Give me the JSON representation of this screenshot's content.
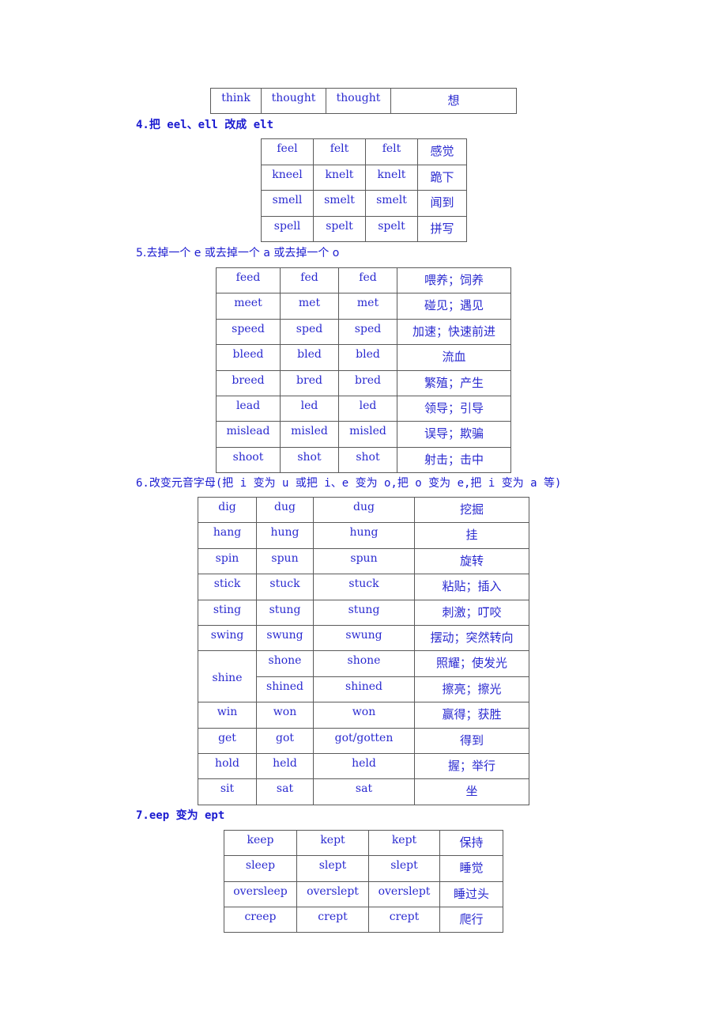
{
  "table_think": [
    [
      "think",
      "thought",
      "thought",
      "想"
    ]
  ],
  "section4": {
    "heading": "4.把 eel、ell 改成 elt",
    "rows": [
      [
        "feel",
        "felt",
        "felt",
        "感觉"
      ],
      [
        "kneel",
        "knelt",
        "knelt",
        "跪下"
      ],
      [
        "smell",
        "smelt",
        "smelt",
        "闻到"
      ],
      [
        "spell",
        "spelt",
        "spelt",
        "拼写"
      ]
    ]
  },
  "section5": {
    "heading": "5.去掉一个 e 或去掉一个 a 或去掉一个 o",
    "rows": [
      [
        "feed",
        "fed",
        "fed",
        "喂养；饲养"
      ],
      [
        "meet",
        "met",
        "met",
        "碰见；遇见"
      ],
      [
        "speed",
        "sped",
        "sped",
        "加速；快速前进"
      ],
      [
        "bleed",
        "bled",
        "bled",
        "流血"
      ],
      [
        "breed",
        "bred",
        "bred",
        "繁殖；产生"
      ],
      [
        "lead",
        "led",
        "led",
        "领导；引导"
      ],
      [
        "mislead",
        "misled",
        "misled",
        "误导；欺骗"
      ],
      [
        "shoot",
        "shot",
        "shot",
        "射击；击中"
      ]
    ]
  },
  "section6": {
    "heading": "6.改变元音字母(把 i 变为 u 或把 i、e 变为 o,把 o 变为 e,把 i 变为 a 等)",
    "rows": [
      [
        "dig",
        "dug",
        "dug",
        "挖掘"
      ],
      [
        "hang",
        "hung",
        "hung",
        "挂"
      ],
      [
        "spin",
        "spun",
        "spun",
        "旋转"
      ],
      [
        "stick",
        "stuck",
        "stuck",
        "粘贴；插入"
      ],
      [
        "sting",
        "stung",
        "stung",
        "刺激；叮咬"
      ],
      [
        "swing",
        "swung",
        "swung",
        "摆动；突然转向"
      ]
    ],
    "shine": {
      "base": "shine",
      "variants": [
        [
          "shone",
          "shone",
          "照耀；使发光"
        ],
        [
          "shined",
          "shined",
          "擦亮；擦光"
        ]
      ]
    },
    "rows_after": [
      [
        "win",
        "won",
        "won",
        "赢得；获胜"
      ],
      [
        "get",
        "got",
        "got/gotten",
        "得到"
      ],
      [
        "hold",
        "held",
        "held",
        "握；举行"
      ],
      [
        "sit",
        "sat",
        "sat",
        "坐"
      ]
    ]
  },
  "section7": {
    "heading": "7.eep 变为 ept",
    "rows": [
      [
        "keep",
        "kept",
        "kept",
        "保持"
      ],
      [
        "sleep",
        "slept",
        "slept",
        "睡觉"
      ],
      [
        "oversleep",
        "overslept",
        "overslept",
        "睡过头"
      ],
      [
        "creep",
        "crept",
        "crept",
        "爬行"
      ]
    ]
  }
}
